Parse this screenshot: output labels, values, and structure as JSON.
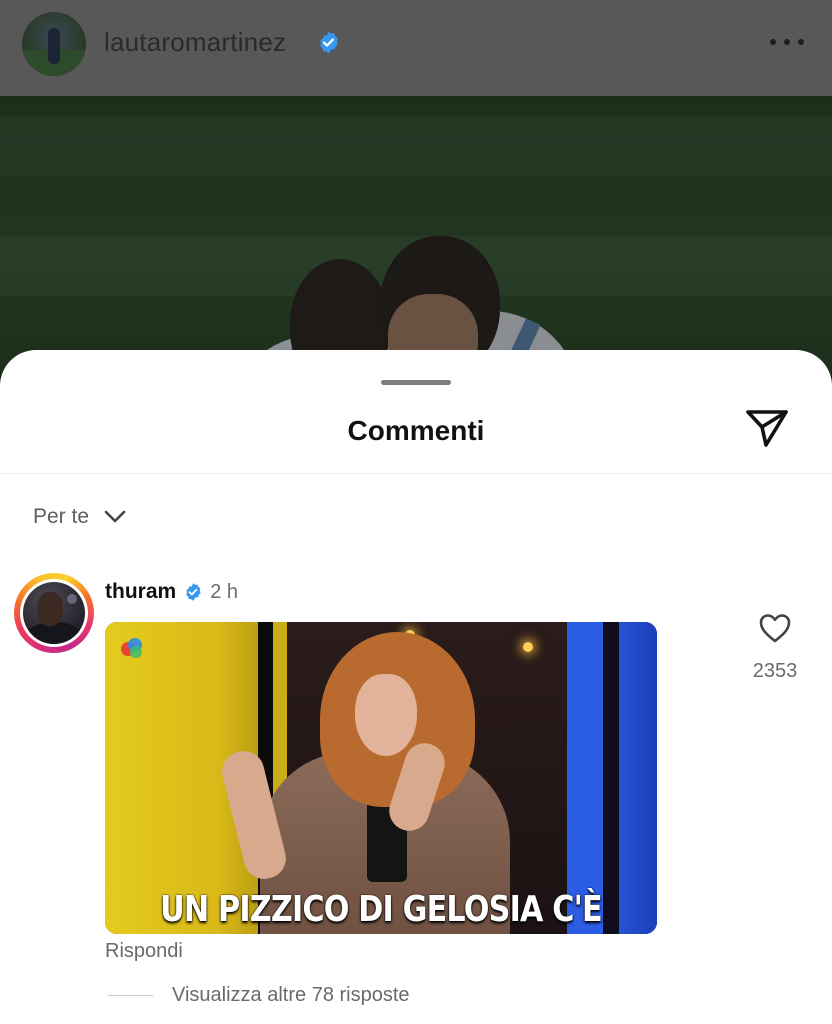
{
  "post": {
    "username": "lautaromartinez",
    "verified": true,
    "more_icon": "more-horizontal-icon"
  },
  "comments_sheet": {
    "title": "Commenti",
    "share_icon": "paper-plane-icon",
    "sort": {
      "label": "Per te",
      "icon": "chevron-down-icon"
    }
  },
  "comment": {
    "username": "thuram",
    "verified": true,
    "time": "2 h",
    "gif_caption": "UN PIZZICO DI GELOSIA C'È",
    "reply_label": "Rispondi",
    "view_replies": "Visualizza altre 78 risposte",
    "like_icon": "heart-outline-icon",
    "like_count": "2353"
  },
  "colors": {
    "verified_blue": "#3897f0",
    "text_primary": "#111111",
    "text_secondary": "#6a6a6a"
  }
}
